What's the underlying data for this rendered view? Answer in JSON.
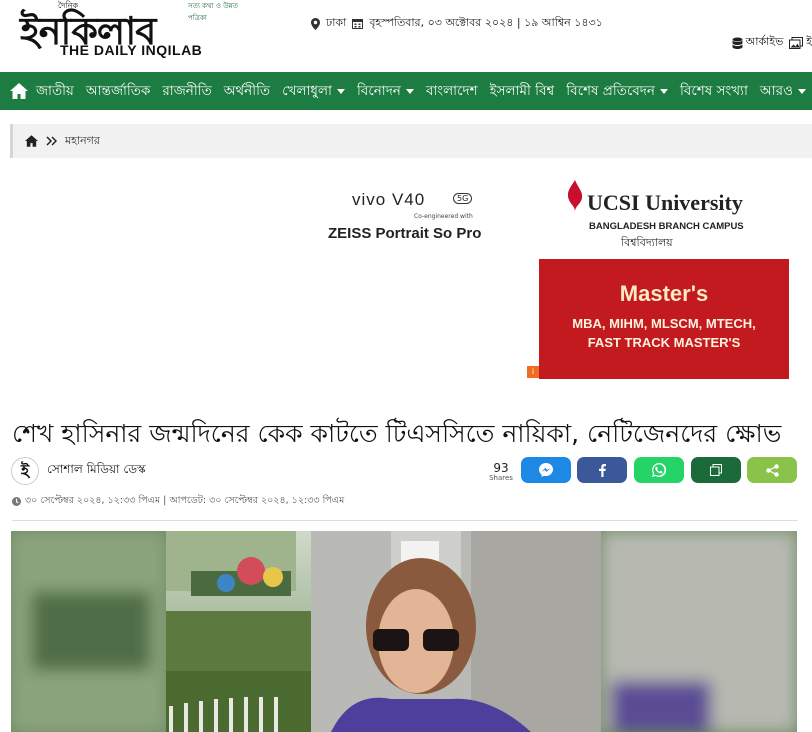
{
  "header": {
    "logo_top_tag": "দৈনিক",
    "logo_tagline": "সত্য কথা ও উন্নত পত্রিকা",
    "logo_text": "ইনকিলাব",
    "logo_sub": "THE DAILY INQILAB",
    "location": "ঢাকা",
    "date": "বৃহস্পতিবার, ০৩ অক্টোবর ২০২৪ | ১৯ আশ্বিন ১৪৩১",
    "archive_label": "আর্কাইভ",
    "second_label": "ই"
  },
  "nav": {
    "items": [
      {
        "label": "জাতীয়"
      },
      {
        "label": "আন্তর্জাতিক"
      },
      {
        "label": "রাজনীতি"
      },
      {
        "label": "অর্থনীতি"
      },
      {
        "label": "খেলাধুলা"
      },
      {
        "label": "বিনোদন"
      },
      {
        "label": "বাংলাদেশ"
      },
      {
        "label": "ইসলামী বিশ্ব"
      },
      {
        "label": "বিশেষ প্রতিবেদন"
      },
      {
        "label": "বিশেষ সংখ্যা"
      },
      {
        "label": "আরও"
      }
    ]
  },
  "breadcrumb": {
    "current": "মহানগর"
  },
  "ads": {
    "vivo_title": "vivo V40",
    "vivo_badge": "5G",
    "vivo_co": "Co-engineered with",
    "vivo_zeiss": "ZEISS Portrait So Pro",
    "ucsi_name": "UCSI University",
    "ucsi_campus": "BANGLADESH BRANCH CAMPUS",
    "ucsi_bn": "বিশ্ববিদ্যালয়",
    "promo_title": "Master's",
    "promo_line1": "MBA, MIHM, MLSCM, MTECH,",
    "promo_line2": "FAST TRACK MASTER'S"
  },
  "article": {
    "headline": "শেখ হাসিনার জন্মদিনের কেক কাটতে টিএসসিতে নায়িকা, নেটিজেনদের ক্ষোভ",
    "author_avatar": "ই",
    "author": "সোশাল মিডিয়া ডেস্ক",
    "shares_count": "93",
    "shares_label": "Shares",
    "timestamp": "৩০ সেপ্টেম্বর ২০২৪, ১২:৩৩ পিএম | আপডেট: ৩০ সেপ্টেম্বর ২০২৪, ১২:৩৩ পিএম"
  },
  "colors": {
    "nav_bg": "#1d7c41",
    "messenger": "#1e88e5",
    "facebook": "#3b5998",
    "whatsapp": "#25d366",
    "copy": "#1b6b3a",
    "share": "#8bc34a",
    "promo_bg": "#c21a1e"
  }
}
